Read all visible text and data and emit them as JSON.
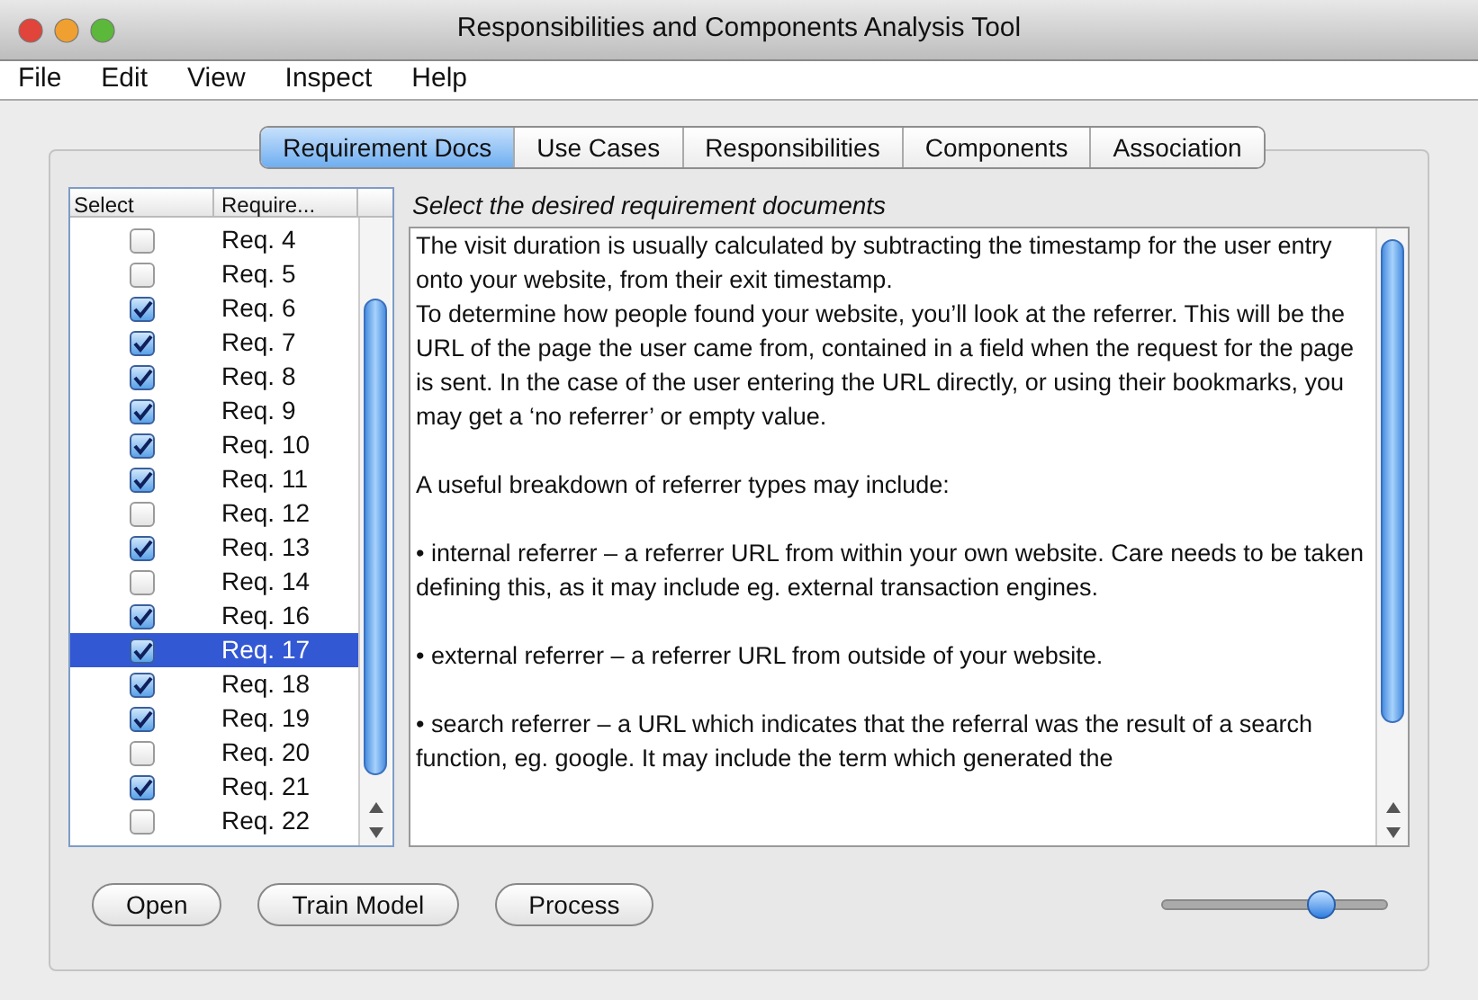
{
  "window": {
    "title": "Responsibilities and Components Analysis Tool"
  },
  "menu": [
    "File",
    "Edit",
    "View",
    "Inspect",
    "Help"
  ],
  "tabs": [
    {
      "label": "Requirement Docs",
      "selected": true
    },
    {
      "label": "Use Cases",
      "selected": false
    },
    {
      "label": "Responsibilities",
      "selected": false
    },
    {
      "label": "Components",
      "selected": false
    },
    {
      "label": "Association",
      "selected": false
    }
  ],
  "table": {
    "columns": [
      "Select",
      "Require..."
    ],
    "rows": [
      {
        "name": "Req. 4",
        "checked": false,
        "selected": false
      },
      {
        "name": "Req. 5",
        "checked": false,
        "selected": false
      },
      {
        "name": "Req. 6",
        "checked": true,
        "selected": false
      },
      {
        "name": "Req. 7",
        "checked": true,
        "selected": false
      },
      {
        "name": "Req. 8",
        "checked": true,
        "selected": false
      },
      {
        "name": "Req. 9",
        "checked": true,
        "selected": false
      },
      {
        "name": "Req. 10",
        "checked": true,
        "selected": false
      },
      {
        "name": "Req. 11",
        "checked": true,
        "selected": false
      },
      {
        "name": "Req. 12",
        "checked": false,
        "selected": false
      },
      {
        "name": "Req. 13",
        "checked": true,
        "selected": false
      },
      {
        "name": "Req. 14",
        "checked": false,
        "selected": false
      },
      {
        "name": "Req. 16",
        "checked": true,
        "selected": false
      },
      {
        "name": "Req. 17",
        "checked": true,
        "selected": true
      },
      {
        "name": "Req. 18",
        "checked": true,
        "selected": false
      },
      {
        "name": "Req. 19",
        "checked": true,
        "selected": false
      },
      {
        "name": "Req. 20",
        "checked": false,
        "selected": false
      },
      {
        "name": "Req. 21",
        "checked": true,
        "selected": false
      },
      {
        "name": "Req. 22",
        "checked": false,
        "selected": false
      }
    ]
  },
  "instruction": "Select the desired requirement documents",
  "document": [
    [
      "The visit duration is usually calculated by subtracting the timestamp for the user entry onto your website, from their exit timestamp.",
      "To determine how people found your website, you’ll look at the referrer. This will be the URL of the page the user came from, contained in a field when the request for the page is sent.   In the case of the user entering the URL directly, or using their bookmarks, you may get a ‘no referrer’ or empty value."
    ],
    [
      "A useful breakdown of referrer types may include:"
    ],
    [
      "• internal referrer – a referrer URL from within your own website. Care needs to be taken defining this, as it may include eg. external transaction engines."
    ],
    [
      "• external referrer – a referrer URL from outside of your website."
    ],
    [
      "• search referrer – a URL which indicates that the referral was the result of a search function, eg. google. It may include the term which generated the"
    ]
  ],
  "buttons": [
    "Open",
    "Train Model",
    "Process"
  ],
  "slider": {
    "level": 0.71
  }
}
